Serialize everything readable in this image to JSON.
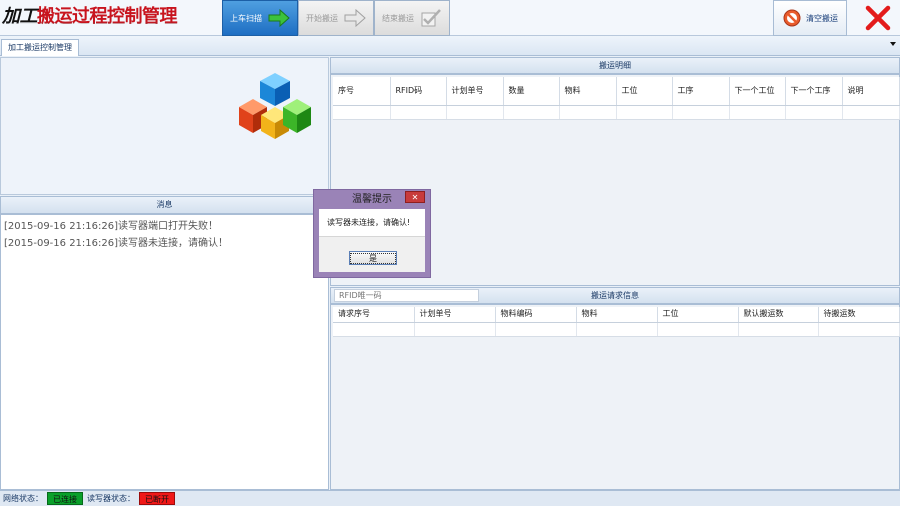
{
  "app": {
    "title_part1": "加工",
    "title_part2": "搬运过程控制管理"
  },
  "toolbar": {
    "scan_label": "上车扫描",
    "start_label": "开始搬运",
    "end_label": "结束搬运",
    "clear_label": "清空搬运"
  },
  "tabs": [
    {
      "label": "加工搬运控制管理"
    }
  ],
  "messages": {
    "header": "消息",
    "lines": [
      "[2015-09-16 21:16:26]读写器端口打开失败！",
      "[2015-09-16 21:16:26]读写器未连接，请确认！"
    ]
  },
  "details": {
    "header": "搬运明细",
    "columns": [
      "序号",
      "RFID码",
      "计划单号",
      "数量",
      "物料",
      "工位",
      "工序",
      "下一个工位",
      "下一个工序",
      "说明"
    ]
  },
  "requests": {
    "rfid_placeholder": "RFID唯一码",
    "header": "搬运请求信息",
    "columns": [
      "请求序号",
      "计划单号",
      "物料编码",
      "物料",
      "工位",
      "默认搬运数",
      "待搬运数"
    ]
  },
  "status": {
    "network_label": "网络状态：",
    "network_value": "已连接",
    "reader_label": "读写器状态：",
    "reader_value": "已断开"
  },
  "dialog": {
    "title": "温馨提示",
    "message": "读写器未连接，请确认!",
    "ok_label": "是"
  },
  "colors": {
    "accent": "#1e6ec3",
    "title_red": "#c8141e",
    "connected": "#0aa02a",
    "disconnected": "#f01818",
    "dialog_frame": "#9a83b7"
  }
}
